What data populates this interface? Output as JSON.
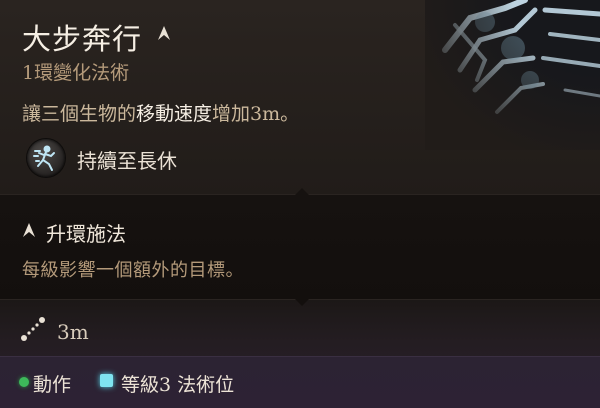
{
  "spell": {
    "name": "大步奔行",
    "level_school": "1環變化法術",
    "description_pre": "讓三個生物的",
    "description_highlight": "移動速度",
    "description_post": "增加3m。",
    "duration": "持續至長休"
  },
  "upcast": {
    "title": "升環施法",
    "description": "每級影響一個額外的目標。"
  },
  "range": "3m",
  "footer": {
    "action": "動作",
    "slot": "等級3 法術位"
  },
  "icons": {
    "spell_art": "longstrider-spell-art",
    "upcast": "upcast-chevron-icon",
    "duration": "running-figure-icon",
    "range": "range-icon",
    "action": "action-dot-icon",
    "slot": "spell-slot-icon"
  },
  "colors": {
    "accent_cyan": "#7fe4f0",
    "action_green": "#3db85a"
  }
}
